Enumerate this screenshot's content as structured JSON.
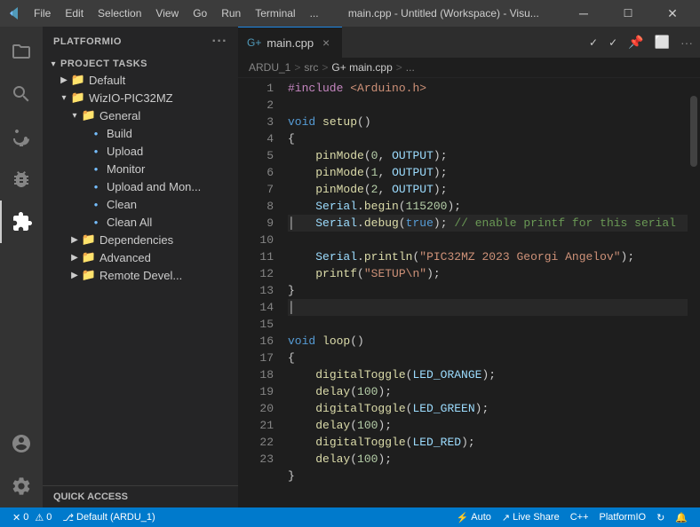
{
  "titleBar": {
    "icon": "●",
    "menus": [
      "File",
      "Edit",
      "Selection",
      "View",
      "Go",
      "Run",
      "Terminal",
      "..."
    ],
    "title": "main.cpp - Untitled (Workspace) - Visu...",
    "controls": [
      "⬜",
      "🗗",
      "✕"
    ]
  },
  "activityBar": {
    "items": [
      {
        "name": "files-icon",
        "icon": "files"
      },
      {
        "name": "search-icon",
        "icon": "search"
      },
      {
        "name": "source-control-icon",
        "icon": "git"
      },
      {
        "name": "debug-icon",
        "icon": "bug"
      },
      {
        "name": "extensions-icon",
        "icon": "extensions"
      },
      {
        "name": "platformio-icon",
        "icon": "pio"
      },
      {
        "name": "settings-icon",
        "icon": "settings"
      }
    ]
  },
  "sidebar": {
    "header": "PLATFORMIO",
    "headerDots": "···",
    "projectTasksLabel": "PROJECT TASKS",
    "items": [
      {
        "id": "default",
        "label": "Default",
        "level": 1,
        "type": "folder",
        "collapsed": true
      },
      {
        "id": "wiziopic32mz",
        "label": "WizIO-PIC32MZ",
        "level": 1,
        "type": "folder",
        "collapsed": false
      },
      {
        "id": "general",
        "label": "General",
        "level": 2,
        "type": "folder",
        "collapsed": false
      },
      {
        "id": "build",
        "label": "Build",
        "level": 3,
        "type": "circle"
      },
      {
        "id": "upload",
        "label": "Upload",
        "level": 3,
        "type": "circle"
      },
      {
        "id": "monitor",
        "label": "Monitor",
        "level": 3,
        "type": "circle"
      },
      {
        "id": "uploadmon",
        "label": "Upload and Mon...",
        "level": 3,
        "type": "circle"
      },
      {
        "id": "clean",
        "label": "Clean",
        "level": 3,
        "type": "circle"
      },
      {
        "id": "cleanall",
        "label": "Clean All",
        "level": 3,
        "type": "circle"
      },
      {
        "id": "dependencies",
        "label": "Dependencies",
        "level": 2,
        "type": "folder",
        "collapsed": true
      },
      {
        "id": "advanced",
        "label": "Advanced",
        "level": 2,
        "type": "folder",
        "collapsed": true
      },
      {
        "id": "remotedev",
        "label": "Remote Devel...",
        "level": 2,
        "type": "folder",
        "collapsed": true
      }
    ],
    "quickAccess": "QUICK ACCESS"
  },
  "tab": {
    "icon": "G+",
    "label": "main.cpp",
    "close": "×"
  },
  "breadcrumb": {
    "parts": [
      "ARDU_1",
      ">",
      "src",
      ">",
      "G+ main.cpp",
      ">",
      "..."
    ]
  },
  "code": {
    "lines": [
      {
        "n": 1,
        "text": "#include <Arduino.h>"
      },
      {
        "n": 2,
        "text": ""
      },
      {
        "n": 3,
        "text": "void setup()"
      },
      {
        "n": 4,
        "text": "{"
      },
      {
        "n": 5,
        "text": "    pinMode(0, OUTPUT);"
      },
      {
        "n": 6,
        "text": "    pinMode(1, OUTPUT);"
      },
      {
        "n": 7,
        "text": "    pinMode(2, OUTPUT);"
      },
      {
        "n": 8,
        "text": "    Serial.begin(115200);"
      },
      {
        "n": 9,
        "text": "    Serial.debug(true); // enable printf for this serial"
      },
      {
        "n": 10,
        "text": "    Serial.println(\"PIC32MZ 2023 Georgi Angelov\");"
      },
      {
        "n": 11,
        "text": "    printf(\"SETUP\\n\");"
      },
      {
        "n": 12,
        "text": "}"
      },
      {
        "n": 13,
        "text": ""
      },
      {
        "n": 14,
        "text": "void loop()"
      },
      {
        "n": 15,
        "text": "{"
      },
      {
        "n": 16,
        "text": "    digitalToggle(LED_ORANGE);"
      },
      {
        "n": 17,
        "text": "    delay(100);"
      },
      {
        "n": 18,
        "text": "    digitalToggle(LED_GREEN);"
      },
      {
        "n": 19,
        "text": "    delay(100);"
      },
      {
        "n": 20,
        "text": "    digitalToggle(LED_RED);"
      },
      {
        "n": 21,
        "text": "    delay(100);"
      },
      {
        "n": 22,
        "text": "}"
      },
      {
        "n": 23,
        "text": ""
      }
    ]
  },
  "statusBar": {
    "errors": "0",
    "warnings": "0",
    "branch": "Default (ARDU_1)",
    "auto": "Auto",
    "liveShare": "Live Share",
    "language": "C++",
    "platform": "PlatformIO",
    "sync": "↻",
    "bell": "🔔"
  }
}
